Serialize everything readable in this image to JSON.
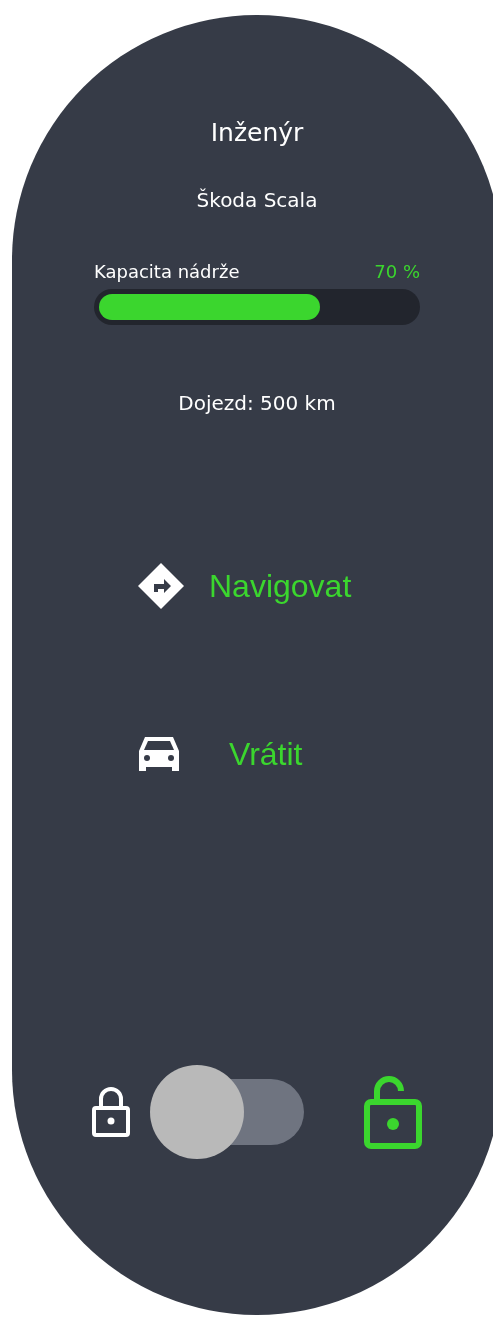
{
  "title": "Inženýr",
  "car": "Škoda Scala",
  "fuel": {
    "label": "Kapacita nádrže",
    "reading": "70 %",
    "level": 0.7
  },
  "range": "Dojezd: 500 km",
  "actions": [
    {
      "kind": "navigate",
      "label": "Navigovat"
    },
    {
      "kind": "return",
      "label": "Vrátit"
    }
  ],
  "lock": {
    "unlocked": true
  }
}
